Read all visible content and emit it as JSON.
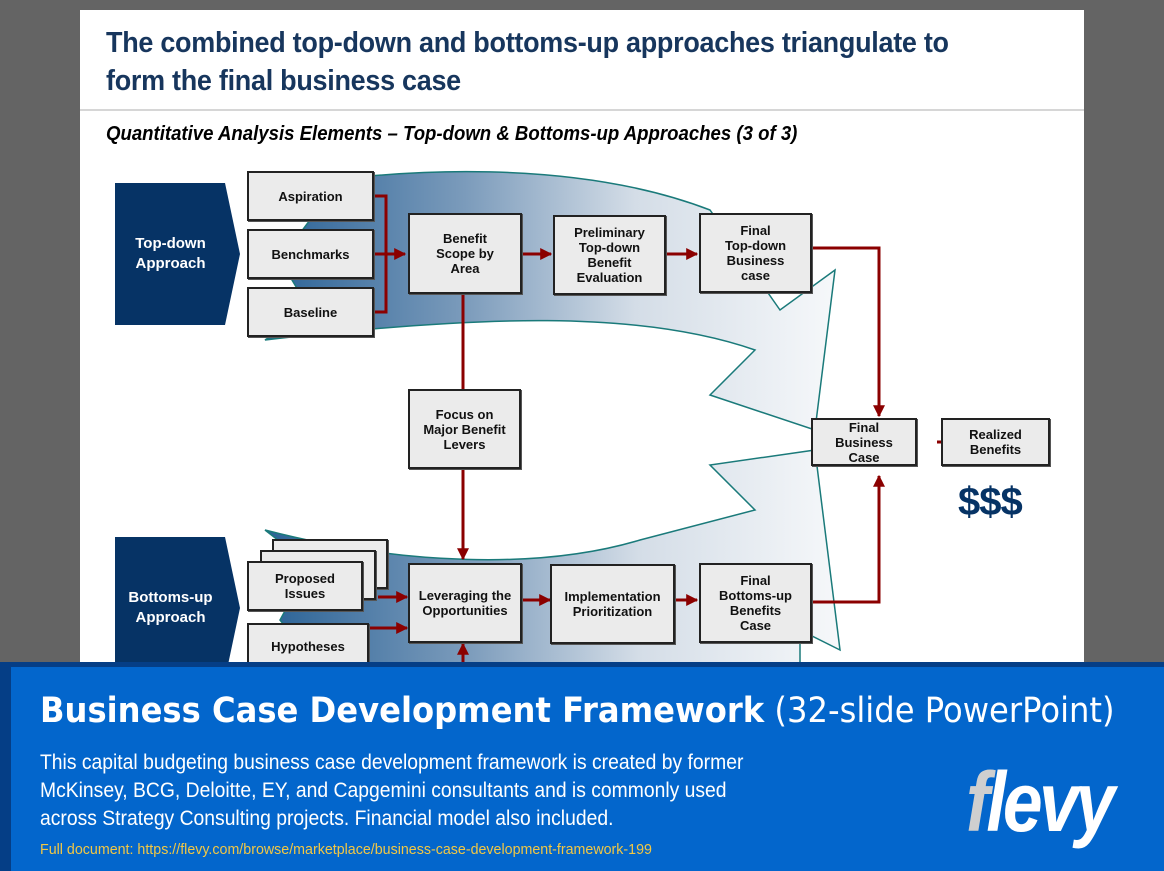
{
  "slide": {
    "title": "The combined top-down and bottoms-up approaches triangulate to form the final business case",
    "subtitle": "Quantitative Analysis Elements – Top-down & Bottoms-up Approaches (3 of 3)"
  },
  "diagram": {
    "approaches": {
      "top_down": "Top-down\nApproach",
      "bottoms_up": "Bottoms-up\nApproach"
    },
    "top_down_inputs": [
      "Aspiration",
      "Benchmarks",
      "Baseline"
    ],
    "top_down_steps": [
      "Benefit\nScope by\nArea",
      "Preliminary\nTop-down\nBenefit\nEvaluation",
      "Final\nTop-down\nBusiness\ncase"
    ],
    "focus_box": "Focus on\nMajor Benefit\nLevers",
    "bottoms_up_inputs": [
      "Proposed\nIssues",
      "Hypotheses"
    ],
    "bottoms_up_steps": [
      "Leveraging the\nOpportunities",
      "Implementation\nPrioritization",
      "Final\nBottoms-up\nBenefits\nCase"
    ],
    "final_business_case": "Final\nBusiness\nCase",
    "realized_benefits": "Realized\nBenefits",
    "dollars": "$$$",
    "colors": {
      "arrow": "#8b0000",
      "approach_fill": "#063365",
      "band_outline": "#1a7a7a",
      "band_dark": "#2f6a9c"
    }
  },
  "banner": {
    "title_bold": "Business Case Development Framework",
    "title_light": "(32-slide PowerPoint)",
    "description": "This capital budgeting business case development framework is created by former McKinsey, BCG, Deloitte, EY, and Capgemini consultants and is commonly used across Strategy Consulting projects. Financial model also included.",
    "link": "Full document: https://flevy.com/browse/marketplace/business-case-development-framework-199",
    "logo_first": "f",
    "logo_rest": "levy"
  }
}
